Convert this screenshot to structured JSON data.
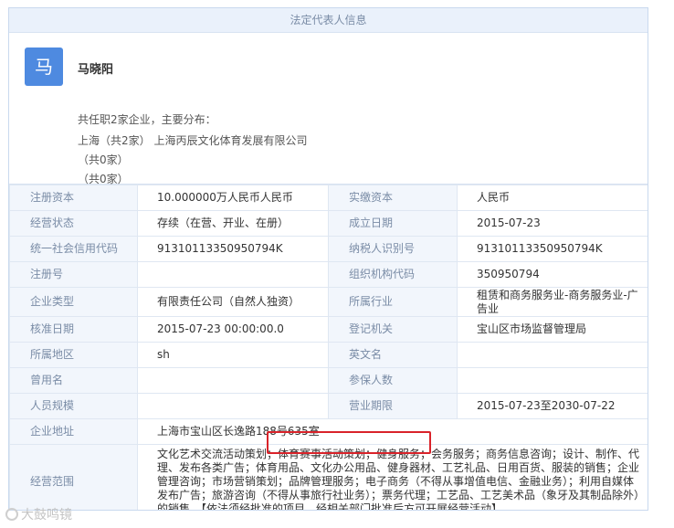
{
  "section_title": "法定代表人信息",
  "person": {
    "avatar_char": "马",
    "name": "马晓阳",
    "summary": "共任职2家企业，主要分布：",
    "distribution": [
      {
        "region": "上海（共2家）",
        "company": "上海丙辰文化体育发展有限公司"
      },
      {
        "region": "（共0家）",
        "company": ""
      },
      {
        "region": "（共0家）",
        "company": ""
      }
    ]
  },
  "rows": [
    {
      "k1": "注册资本",
      "v1": "10.000000万人民币人民币",
      "k2": "实缴资本",
      "v2": "人民币"
    },
    {
      "k1": "经营状态",
      "v1": "存续（在营、开业、在册）",
      "k2": "成立日期",
      "v2": "2015-07-23"
    },
    {
      "k1": "统一社会信用代码",
      "v1": "91310113350950794K",
      "k2": "纳税人识别号",
      "v2": "91310113350950794K"
    },
    {
      "k1": "注册号",
      "v1": "",
      "k2": "组织机构代码",
      "v2": "350950794"
    },
    {
      "k1": "企业类型",
      "v1": "有限责任公司（自然人独资）",
      "k2": "所属行业",
      "v2": "租赁和商务服务业-商务服务业-广告业"
    },
    {
      "k1": "核准日期",
      "v1": "2015-07-23 00:00:00.0",
      "k2": "登记机关",
      "v2": "宝山区市场监督管理局"
    },
    {
      "k1": "所属地区",
      "v1": "sh",
      "k2": "英文名",
      "v2": ""
    },
    {
      "k1": "曾用名",
      "v1": "",
      "k2": "参保人数",
      "v2": ""
    },
    {
      "k1": "人员规模",
      "v1": "",
      "k2": "营业期限",
      "v2": "2015-07-23至2030-07-22"
    }
  ],
  "address": {
    "label": "企业地址",
    "value": "上海市宝山区长逸路188号635室"
  },
  "scope": {
    "label": "经营范围",
    "value": "文化艺术交流活动策划；体育赛事活动策划；健身服务；会务服务；商务信息咨询；设计、制作、代理、发布各类广告；体育用品、文化办公用品、健身器材、工艺礼品、日用百货、服装的销售；企业管理咨询；市场营销策划；品牌管理服务；电子商务（不得从事增值电信、金融业务）；利用自媒体发布广告；旅游咨询（不得从事旅行社业务）；票务代理；工艺品、工艺美术品（象牙及其制品除外）的销售。【依法须经批准的项目，经相关部门批准后方可开展经营活动】"
  },
  "watermark": "大鼓鸣镜"
}
